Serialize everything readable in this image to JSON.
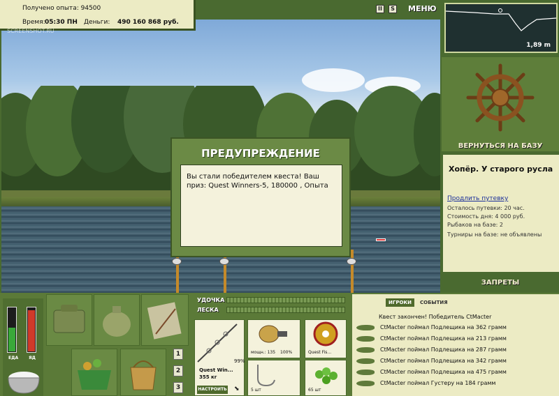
{
  "info": {
    "xp_label": "Получено опыта:",
    "xp_value": "94500",
    "time_label": "Время:",
    "time_value": "05:30 ПН",
    "money_label": "Деньги:",
    "money_value": "490 160 868 руб."
  },
  "watermark": "SCREENSHOT.RU",
  "top_bar": {
    "pause": "II",
    "sound": "S",
    "menu": "МЕНЮ"
  },
  "depth": "1,89 m",
  "return_button": "ВЕРНУТЬСЯ НА БАЗУ",
  "location": {
    "title": "Хопёр. У старого русла",
    "extend_link": "Продлить путевку",
    "trip_left": "Осталось путевки: 20 час.",
    "day_cost": "Стоимость дня: 4 000 руб.",
    "fishers": "Рыбаков на базе: 2",
    "tournaments": "Турниры на базе: не объявлены"
  },
  "bans_button": "ЗАПРЕТЫ",
  "warning": {
    "title": "ПРЕДУПРЕЖДЕНИЕ",
    "message": "Вы стали победителем квеста! Ваш приз: Quest Winners-5, 180000 , Опыта"
  },
  "energy": {
    "food_label": "ЕДА",
    "poison_label": "ЯД",
    "food_level": 0.55,
    "poison_level": 0.95
  },
  "pages": [
    "1",
    "2",
    "3"
  ],
  "tackle": {
    "rod_label": "УДОЧКА",
    "line_label": "ЛЕСКА",
    "rod_name": "Quest Win...",
    "rod_weight": "355 кг",
    "rod_percent": "99%",
    "setup_button": "НАСТРОИТЬ",
    "reel_power": "мощн.: 135",
    "reel_percent": "100%",
    "line_name": "Quest Fis...",
    "hook_count": "5 шт",
    "bait_count": "65 шт"
  },
  "events": {
    "tabs": [
      "ИГРОКИ",
      "СОБЫТИЯ"
    ],
    "header": "Квест закончен! Победитель CtMacter",
    "items": [
      "CtMacter поймал Подлещика на 362 грамм",
      "CtMacter поймал Подлещика на 213 грамм",
      "CtMacter поймал Подлещика на 287 грамм",
      "CtMacter поймал Подлещика на 342 грамм",
      "CtMacter поймал Подлещика на 475 грамм",
      "CtMacter поймал Густеру на 184 грамм"
    ]
  }
}
